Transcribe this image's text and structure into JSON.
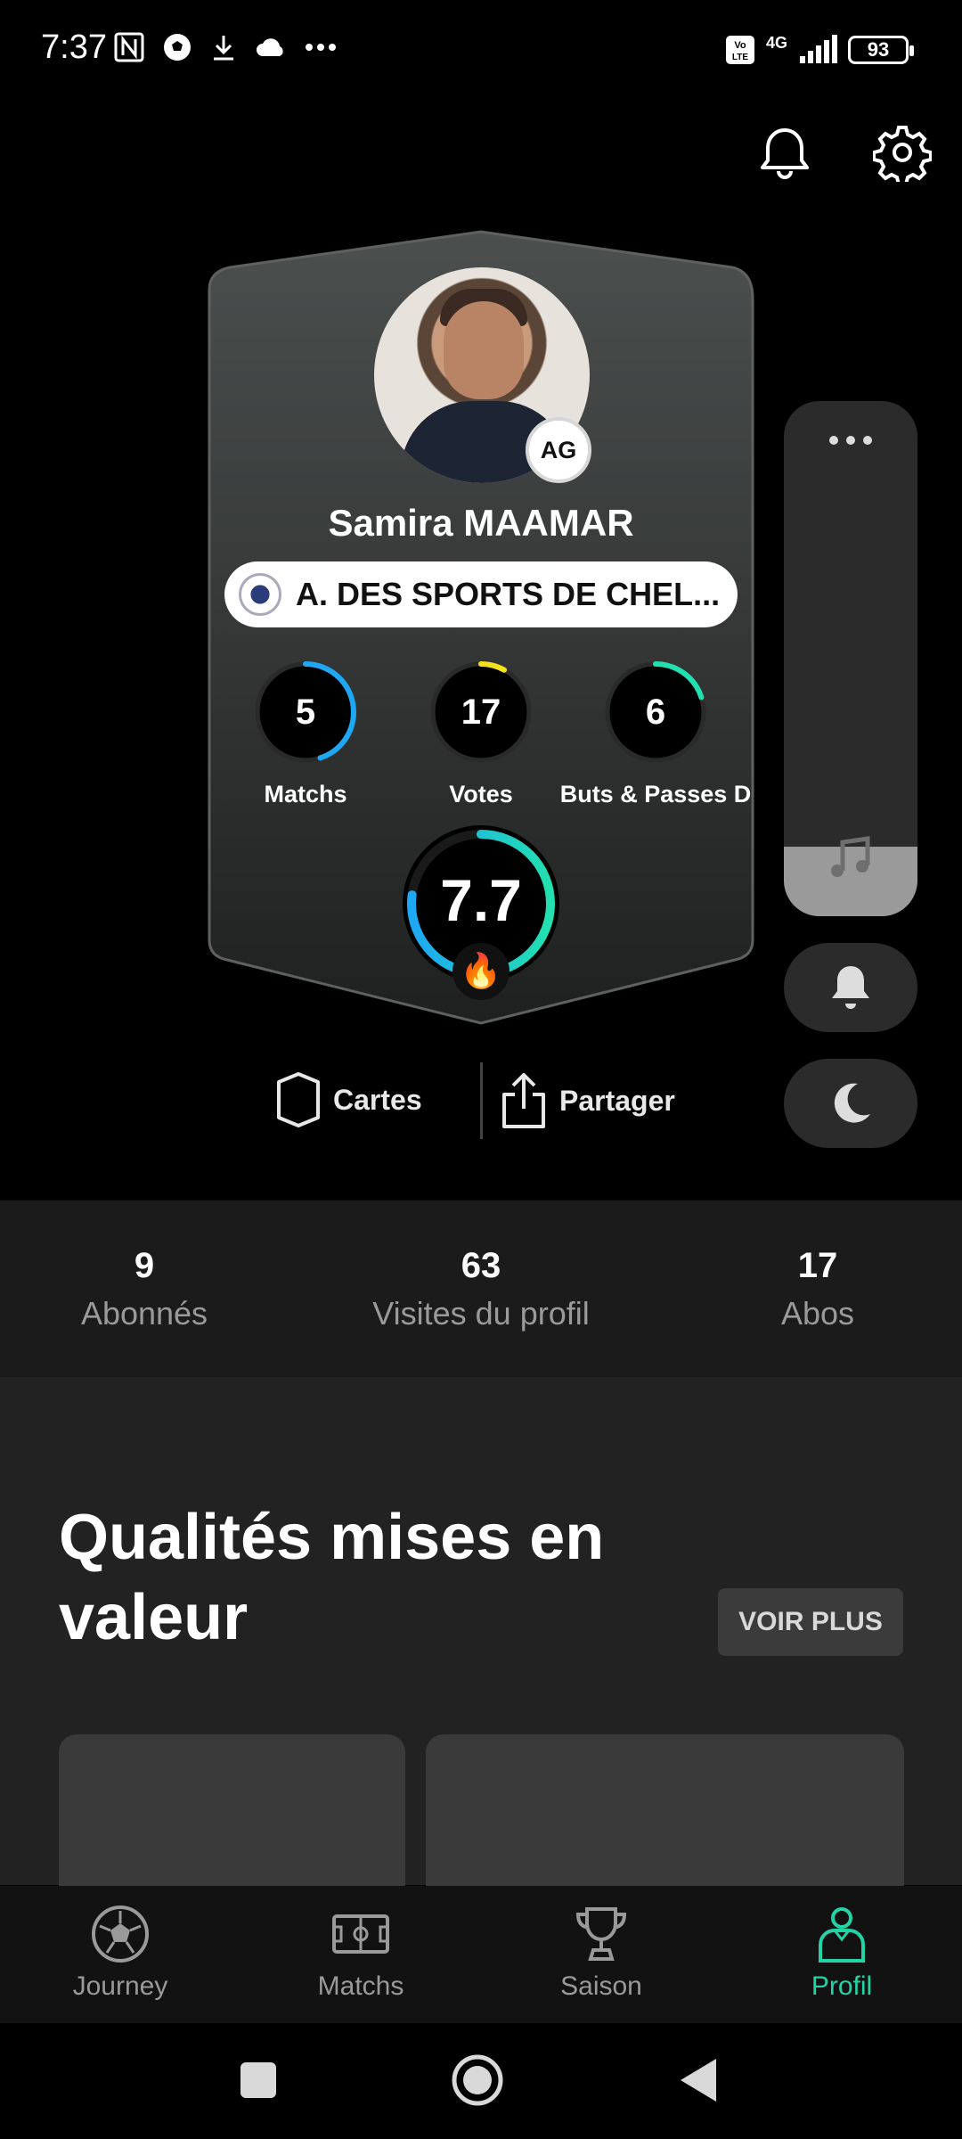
{
  "status_bar": {
    "time": "7:37",
    "battery": "93",
    "network": "4G"
  },
  "header": {
    "notifications_icon": "bell-icon",
    "settings_icon": "gear-icon"
  },
  "profile": {
    "initials": "AG",
    "name": "Samira MAAMAR",
    "club": "A. DES SPORTS DE CHEL...",
    "stats": [
      {
        "value": "5",
        "label": "Matchs",
        "color": "#1ea7f5",
        "fraction": 0.45
      },
      {
        "value": "17",
        "label": "Votes",
        "color": "#f2e21c",
        "fraction": 0.08
      },
      {
        "value": "6",
        "label": "Buts & Passes D",
        "color": "#22e0b0",
        "fraction": 0.2
      }
    ],
    "rating": "7.7",
    "rating_fraction": 0.77
  },
  "actions": {
    "cards_label": "Cartes",
    "share_label": "Partager"
  },
  "side_controls": {
    "more_icon": "more-icon",
    "music_icon": "music-note-icon",
    "bell_icon": "bell-icon",
    "moon_icon": "moon-icon"
  },
  "social": [
    {
      "value": "9",
      "label": "Abonnés"
    },
    {
      "value": "63",
      "label": "Visites du profil"
    },
    {
      "value": "17",
      "label": "Abos"
    }
  ],
  "qualities": {
    "title": "Qualités mises en valeur",
    "more_button": "VOIR PLUS"
  },
  "bottom_nav": [
    {
      "label": "Journey",
      "icon": "football-icon",
      "active": false
    },
    {
      "label": "Matchs",
      "icon": "pitch-icon",
      "active": false
    },
    {
      "label": "Saison",
      "icon": "trophy-icon",
      "active": false
    },
    {
      "label": "Profil",
      "icon": "player-icon",
      "active": true
    }
  ],
  "colors": {
    "accent": "#22d3a5",
    "card_top": "#4a4e4d",
    "card_bottom": "#1e1f1f"
  }
}
